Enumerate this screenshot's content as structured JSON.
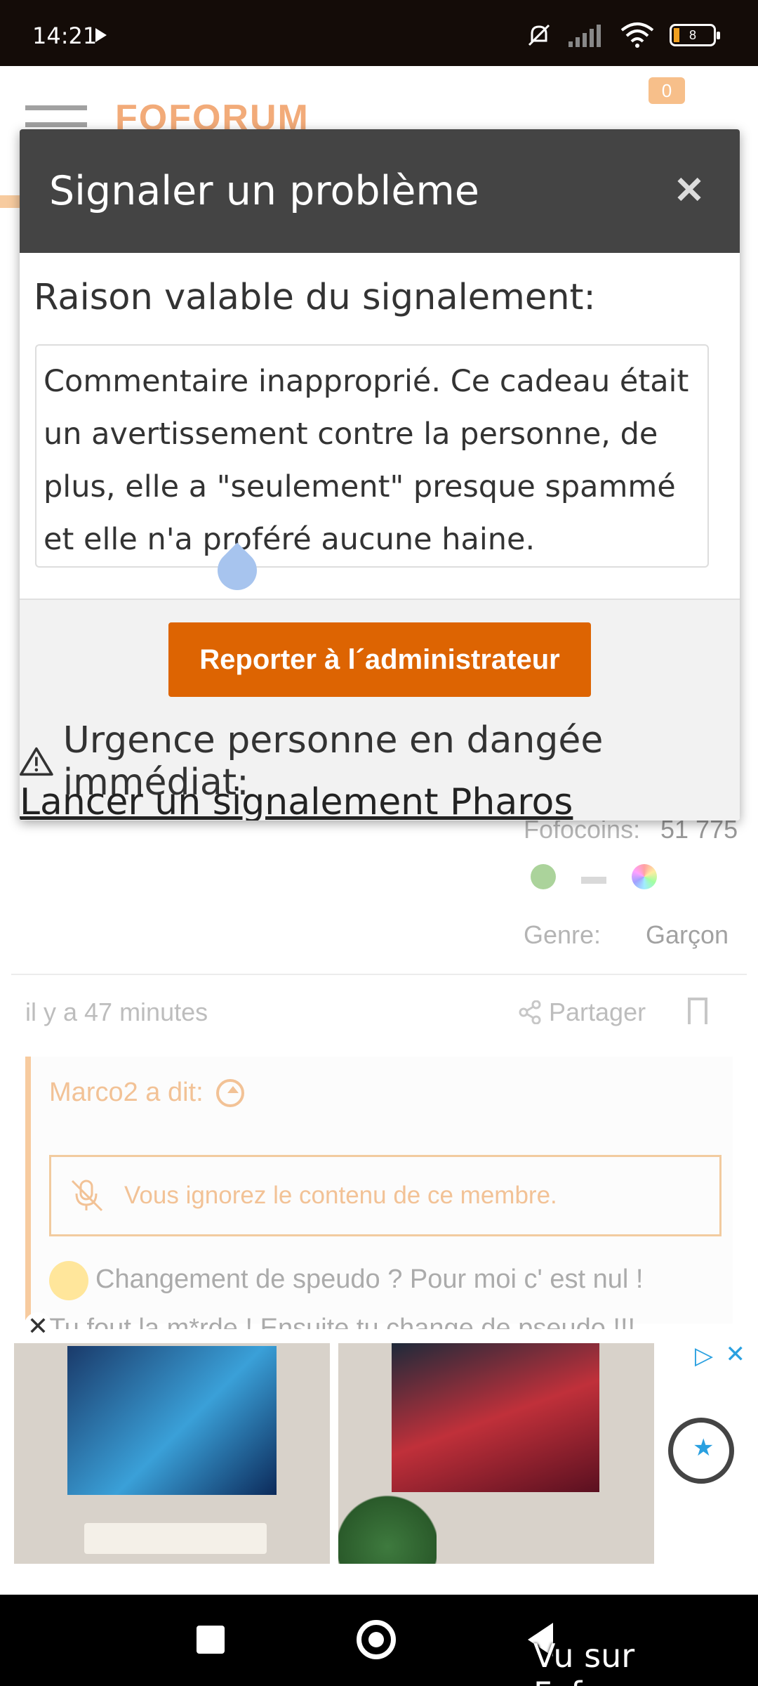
{
  "status_bar": {
    "time": "14:21",
    "battery": "8"
  },
  "forum": {
    "logo": "FOFORUM",
    "notification_count": "0",
    "profile": {
      "fofocoins_label": "Fofocoins:",
      "fofocoins_value": "51 775",
      "genre_label": "Genre:",
      "genre_value": "Garçon"
    },
    "post": {
      "time": "il y a 47 minutes",
      "share_label": "Partager",
      "quote_author": "Marco2 a dit:",
      "ignore_notice": "Vous ignorez le contenu de ce membre.",
      "quote_text_line1": "Changement de speudo ? Pour moi c' est nul !",
      "quote_text_line2": "Tu fout la m*rde ! Ensuite tu change de pseudo !!!"
    }
  },
  "modal": {
    "title": "Signaler un problème",
    "reason_label": "Raison valable du signalement:",
    "reason_text": "Commentaire inapproprié. Ce cadeau était un avertissement contre la personne, de plus, elle a \"seulement\" presque spammé et elle n'a proféré aucune haine.",
    "report_button": "Reporter à l´administrateur",
    "urgent_text": "Urgence personne en dangée immédiat:",
    "pharos_link": "Lancer un signalement Pharos"
  },
  "ad": {
    "close_left": "✕",
    "close_right": "✕",
    "choices": "▷"
  },
  "watermark": "Vu sur Foforum",
  "colors": {
    "accent_orange": "#dd6402",
    "modal_header": "#444444",
    "quote_orange": "#e89040"
  }
}
